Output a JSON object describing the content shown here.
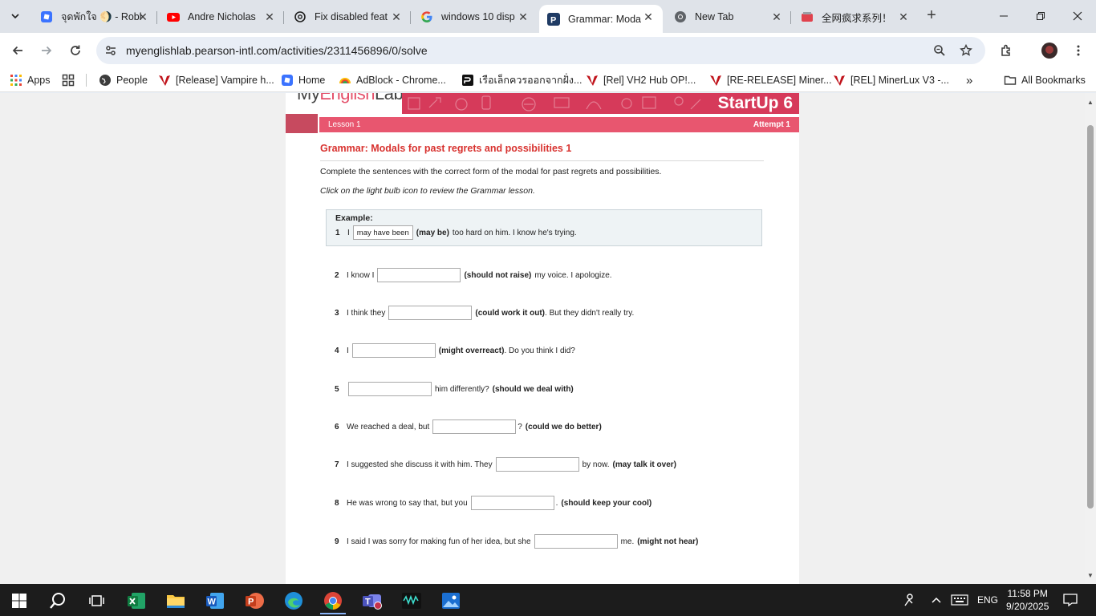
{
  "browser": {
    "tabs": [
      {
        "title": "จุดพักใจ 🌖 - Robl",
        "icon": "roblox-icon",
        "active": false
      },
      {
        "title": "Andre Nicholas",
        "icon": "youtube-icon",
        "active": false
      },
      {
        "title": "Fix disabled feat",
        "icon": "openai-icon",
        "active": false
      },
      {
        "title": "windows 10 disp",
        "icon": "google-icon",
        "active": false
      },
      {
        "title": "Grammar: Moda",
        "icon": "pearson-icon",
        "active": true
      },
      {
        "title": "New Tab",
        "icon": "chrome-icon",
        "active": false
      },
      {
        "title": "全网疯求系列！",
        "icon": "bilibili-icon",
        "active": false
      }
    ],
    "url": "myenglishlab.pearson-intl.com/activities/2311456896/0/solve",
    "bookmarks": [
      {
        "label": "Apps"
      },
      {
        "label": ""
      },
      {
        "label": "People"
      },
      {
        "label": "[Release] Vampire h..."
      },
      {
        "label": "Home"
      },
      {
        "label": "AdBlock - Chrome..."
      },
      {
        "label": "เรือเล็กควรออกจากฝั่ง..."
      },
      {
        "label": "[Rel] VH2 Hub OP!..."
      },
      {
        "label": "[RE-RELEASE] Miner..."
      },
      {
        "label": "[REL] MinerLux V3 -..."
      }
    ],
    "all_bookmarks": "All Bookmarks",
    "more": "»"
  },
  "page": {
    "logo_prefix": "My",
    "logo_brand": "English",
    "logo_suffix": "Lab",
    "course": "StartUp 6",
    "lesson": "Lesson 1",
    "attempt": "Attempt 1",
    "title": "Grammar: Modals for past regrets and possibilities 1",
    "instruction": "Complete the sentences with the correct form of the modal for past regrets and possibilities.",
    "instruction2": "Click on the light bulb icon to review the Grammar lesson.",
    "example": {
      "label": "Example:",
      "num": "1",
      "before": "I",
      "answer": "may have been",
      "hint": "(may be)",
      "after": "too hard on him. I know he's trying."
    },
    "questions": [
      {
        "num": "2",
        "before": "I know I",
        "value": "",
        "mid": "(should not raise)",
        "after": "my voice. I apologize."
      },
      {
        "num": "3",
        "before": "I think they",
        "value": "",
        "mid": "(could work it out)",
        "after": ". But they didn't really try."
      },
      {
        "num": "4",
        "before": "I",
        "value": "",
        "mid": "(might overreact)",
        "after": ". Do you think I did?"
      },
      {
        "num": "5",
        "before": "",
        "value": "",
        "mid": "him differently?",
        "after": "(should we deal with)"
      },
      {
        "num": "6",
        "before": "We reached a deal, but",
        "value": "",
        "mid": "?",
        "after": "(could we do better)"
      },
      {
        "num": "7",
        "before": "I suggested she discuss it with him. They",
        "value": "",
        "mid": "by now.",
        "after": "(may talk it over)"
      },
      {
        "num": "8",
        "before": "He was wrong to say that, but you",
        "value": "",
        "mid": ".",
        "after": "(should keep your cool)"
      },
      {
        "num": "9",
        "before": "I said I was sorry for making fun of her idea, but she",
        "value": "",
        "mid": "me.",
        "after": "(might not hear)"
      }
    ]
  },
  "taskbar": {
    "apps": [
      "windows-start-icon",
      "search-icon",
      "task-view-icon",
      "excel-icon",
      "file-explorer-icon",
      "word-icon",
      "powerpoint-icon",
      "edge-icon",
      "chrome-icon",
      "teams-icon",
      "wave-app-icon",
      "photos-icon"
    ],
    "language": "ENG",
    "time": "11:58 PM",
    "date": "9/20/2025"
  }
}
